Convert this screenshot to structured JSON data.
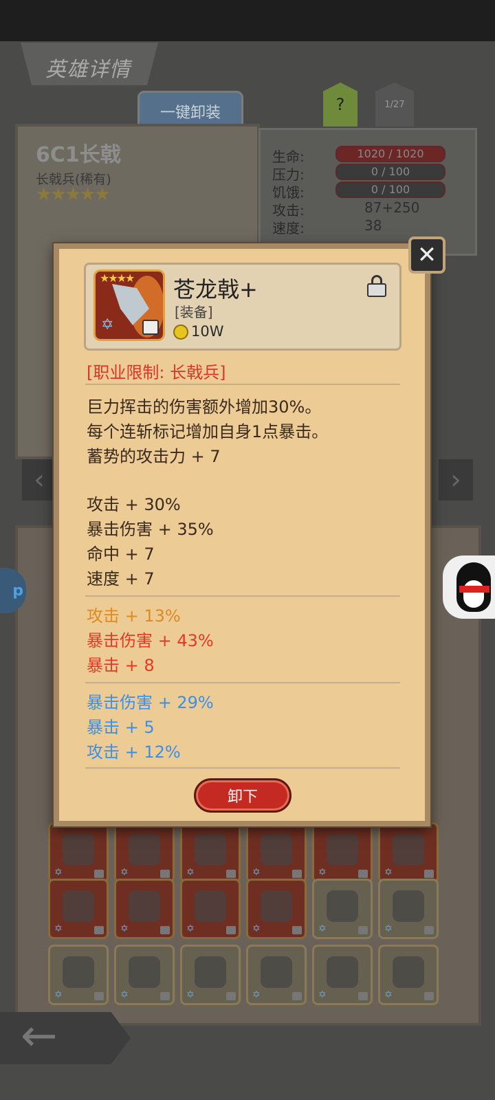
{
  "header": {
    "title": "英雄详情",
    "unequip_all": "一键卸装",
    "hint": "?",
    "page": "1/27"
  },
  "hero": {
    "name": "6C1长戟",
    "class": "长戟兵(稀有)",
    "stars": "★★★★★"
  },
  "stats": [
    {
      "label": "生命:",
      "value": "1020 / 1020",
      "style": "bar-red"
    },
    {
      "label": "压力:",
      "value": "0 / 100",
      "style": "bar"
    },
    {
      "label": "饥饿:",
      "value": "0 / 100",
      "style": "bar"
    },
    {
      "label": "攻击:",
      "value": "87+250",
      "style": "text"
    },
    {
      "label": "速度:",
      "value": "38",
      "style": "text"
    }
  ],
  "item": {
    "name": "苍龙戟+",
    "type": "[装备]",
    "price": "10W",
    "restriction": "[职业限制: 长戟兵]",
    "description": [
      "巨力挥击的伤害额外增加30%。",
      "每个连斩标记增加自身1点暴击。",
      "蓄势的攻击力 + 7"
    ],
    "base_stats": [
      "攻击 + 30%",
      "暴击伤害 + 35%",
      "命中 + 7",
      "速度 + 7"
    ],
    "bonus_orange": [
      "攻击 + 13%"
    ],
    "bonus_red": [
      "暴击伤害 + 43%",
      "暴击 + 8"
    ],
    "bonus_blue": [
      "暴击伤害 + 29%",
      "暴击 + 5",
      "攻击 + 12%"
    ],
    "action": "卸下",
    "close_icon": "close-x-icon"
  },
  "side_bubble": "p",
  "colors": {
    "orange": "#e08a22",
    "red": "#e23a26",
    "blue": "#3a8fe8",
    "panel": "#eccb94"
  }
}
